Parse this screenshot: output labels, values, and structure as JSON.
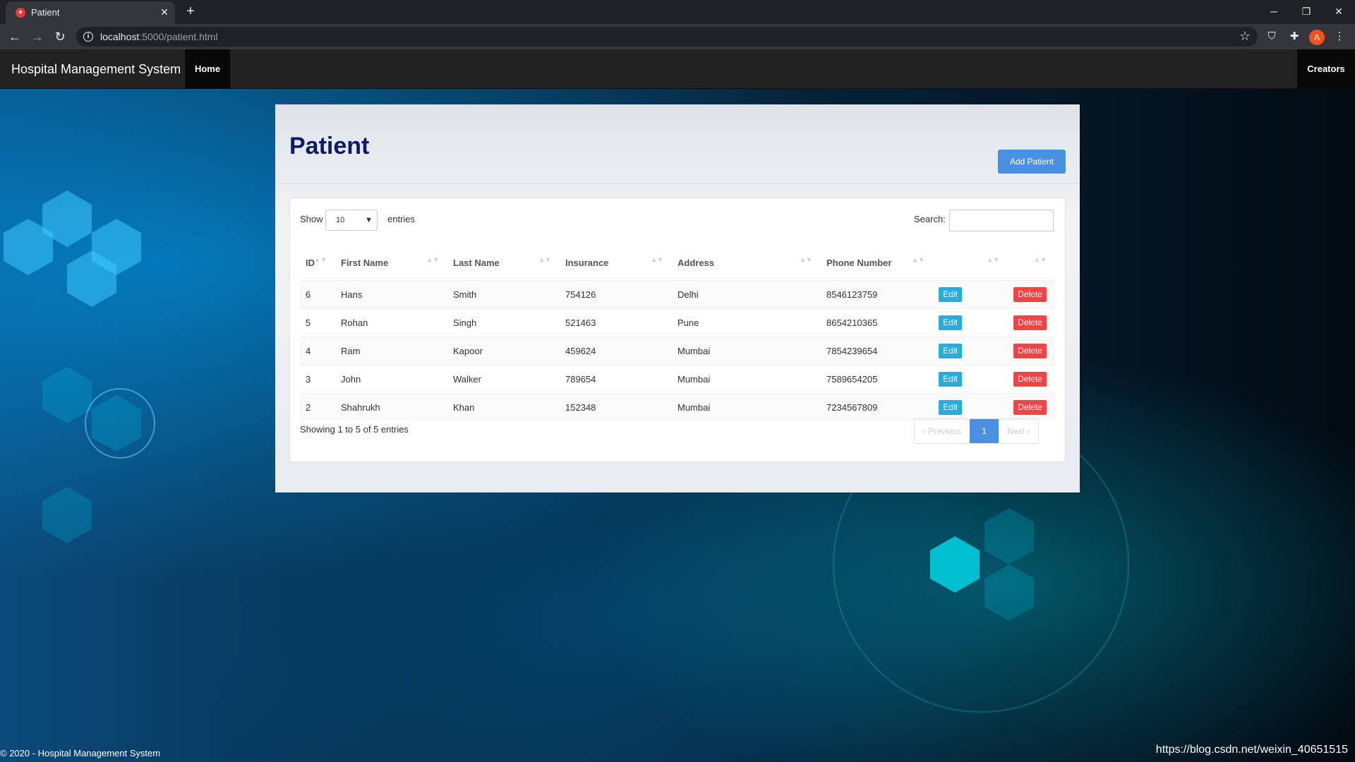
{
  "browser": {
    "tab_title": "Patient",
    "tab_favicon": "hospital-plus-icon",
    "url_host": "localhost",
    "url_path": ":5000/patient.html",
    "profile_initial": "A"
  },
  "navbar": {
    "brand": "Hospital Management System",
    "home": "Home",
    "creators": "Creators"
  },
  "main": {
    "title": "Patient",
    "add_button": "Add Patient",
    "show_label": "Show",
    "entries_value": "10",
    "entries_label": "entries",
    "search_label": "Search:",
    "search_value": "",
    "columns": [
      "ID",
      "First Name",
      "Last Name",
      "Insurance",
      "Address",
      "Phone Number",
      "",
      ""
    ],
    "rows": [
      {
        "id": "6",
        "first": "Hans",
        "last": "Smith",
        "insurance": "754126",
        "address": "Delhi",
        "phone": "8546123759"
      },
      {
        "id": "5",
        "first": "Rohan",
        "last": "Singh",
        "insurance": "521463",
        "address": "Pune",
        "phone": "8654210365"
      },
      {
        "id": "4",
        "first": "Ram",
        "last": "Kapoor",
        "insurance": "459624",
        "address": "Mumbai",
        "phone": "7854239654"
      },
      {
        "id": "3",
        "first": "John",
        "last": "Walker",
        "insurance": "789654",
        "address": "Mumbai",
        "phone": "7589654205"
      },
      {
        "id": "2",
        "first": "Shahrukh",
        "last": "Khan",
        "insurance": "152348",
        "address": "Mumbai",
        "phone": "7234567809"
      }
    ],
    "edit_label": "Edit",
    "delete_label": "Delete",
    "info": "Showing 1 to 5 of 5 entries",
    "pagination": {
      "previous": "Previous",
      "current": "1",
      "next": "Next"
    }
  },
  "footer": "© 2020 - Hospital Management System",
  "watermark": "https://blog.csdn.net/weixin_40651515",
  "colors": {
    "accent": "#4a90e2",
    "edit": "#29abe0",
    "delete": "#f04545",
    "title": "#0c1a6e"
  }
}
